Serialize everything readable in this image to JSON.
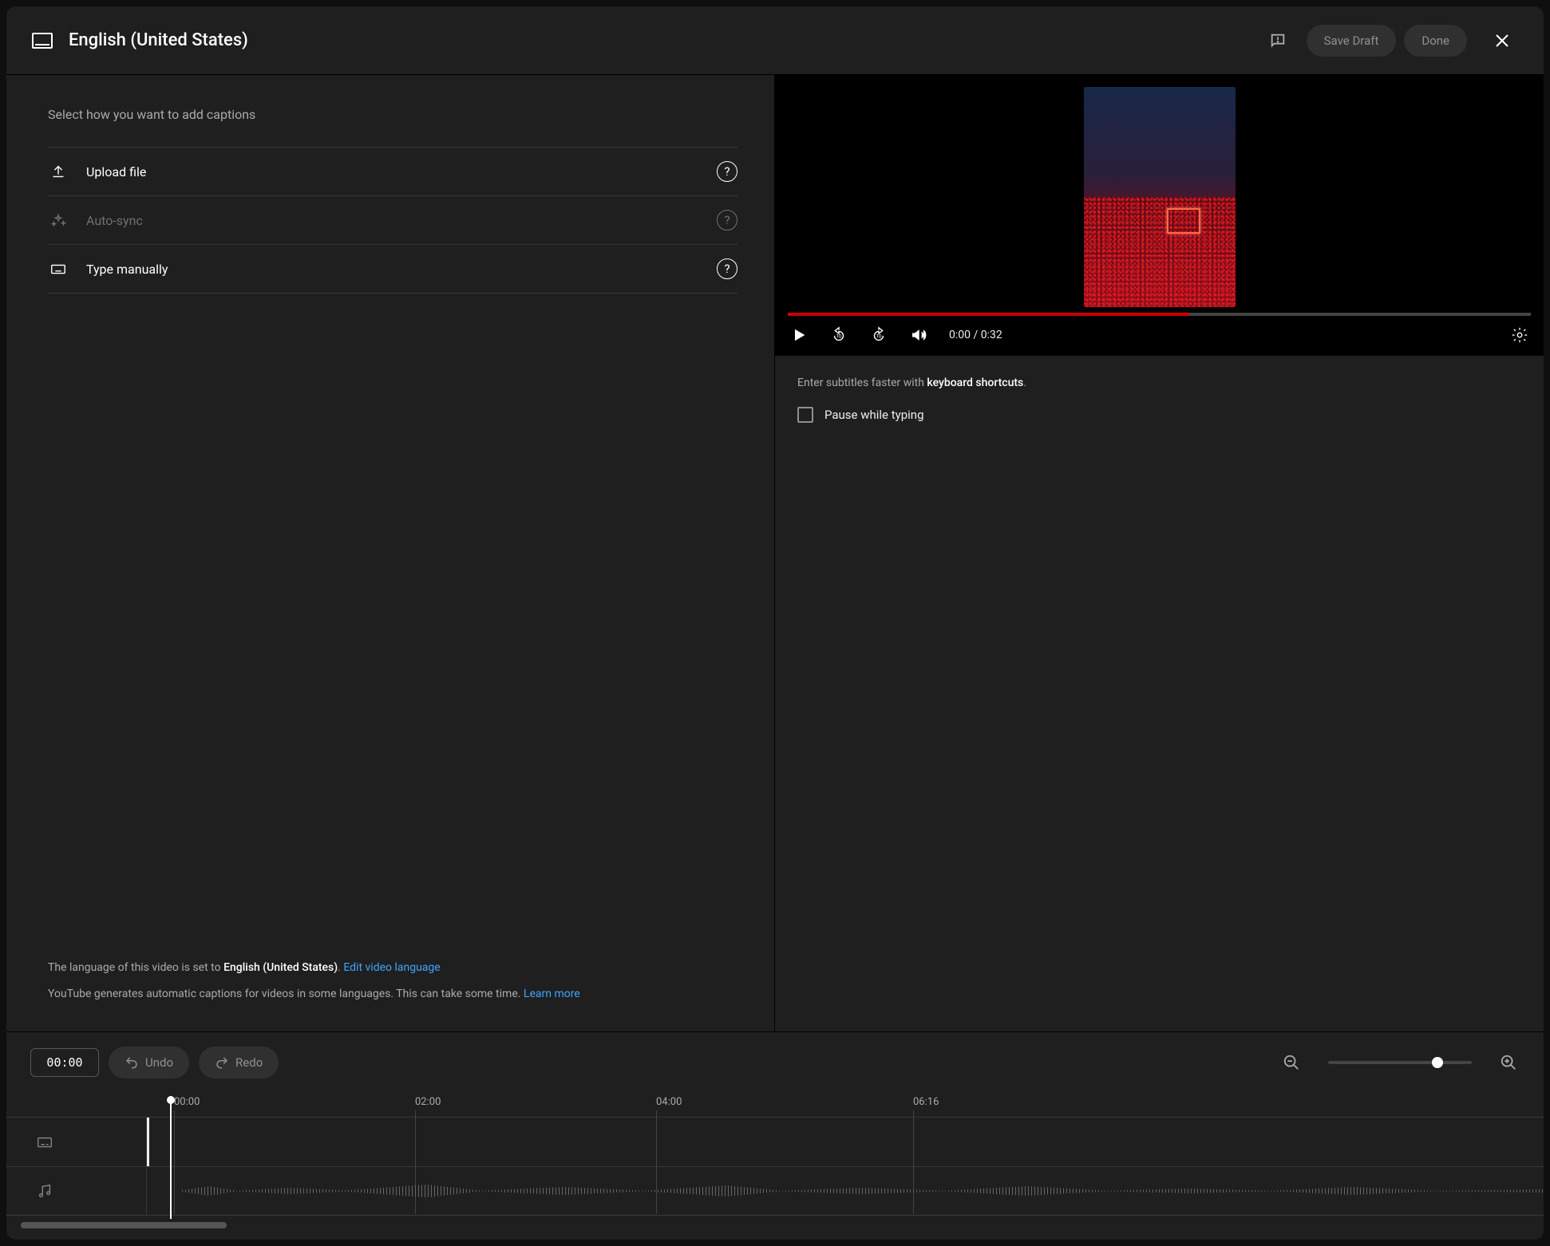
{
  "header": {
    "title": "English (United States)",
    "save_draft": "Save Draft",
    "done": "Done"
  },
  "left": {
    "prompt": "Select how you want to add captions",
    "options": {
      "upload": "Upload file",
      "autosync": "Auto-sync",
      "type": "Type manually"
    },
    "lang_pre": "The language of this video is set to ",
    "lang_val": "English (United States)",
    "lang_dot": ". ",
    "lang_link": "Edit video language",
    "gen_text": "YouTube generates automatic captions for videos in some languages. This can take some time. ",
    "gen_link": "Learn more"
  },
  "player": {
    "time": "0:00 / 0:32"
  },
  "right": {
    "tip_pre": "Enter subtitles faster with ",
    "tip_b": "keyboard shortcuts",
    "tip_post": ".",
    "pause": "Pause while typing"
  },
  "timeline": {
    "timecode": "00:00",
    "undo": "Undo",
    "redo": "Redo",
    "marks": {
      "m0": "00:00",
      "m2": "02:00",
      "m4": "04:00",
      "mend": "06:16"
    }
  }
}
